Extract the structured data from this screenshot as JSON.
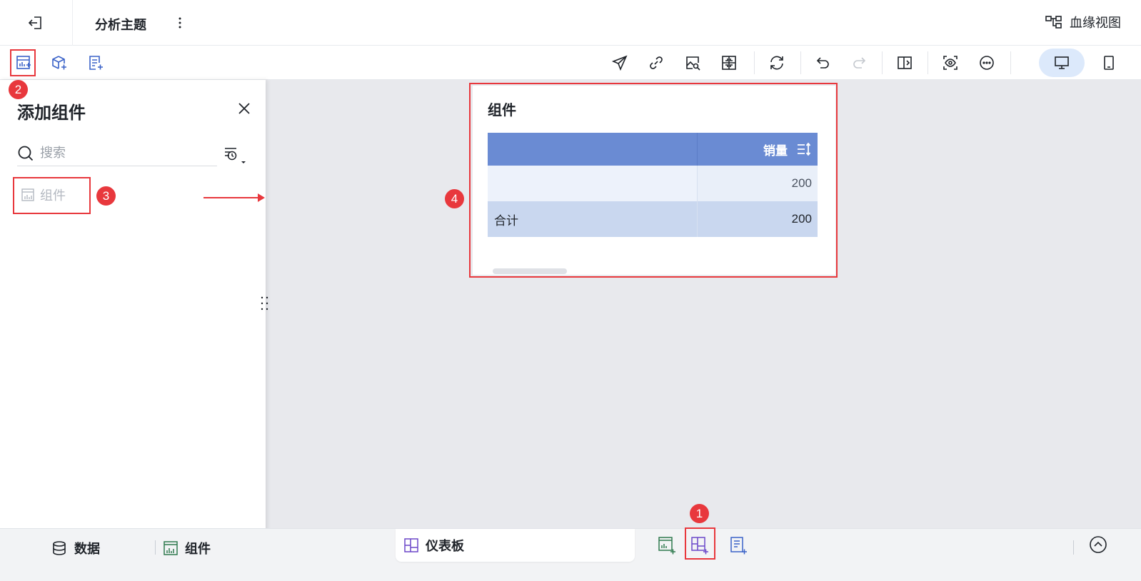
{
  "header": {
    "title": "分析主题",
    "lineage_label": "血缘视图"
  },
  "panel": {
    "title": "添加组件",
    "search_placeholder": "搜索",
    "items": [
      {
        "label": "组件"
      }
    ]
  },
  "widget": {
    "title": "组件",
    "table": {
      "columns": [
        "",
        "销量"
      ],
      "rows": [
        [
          "",
          "200"
        ],
        [
          "合计",
          "200"
        ]
      ]
    }
  },
  "bottom": {
    "data_tab": "数据",
    "component_tab": "组件",
    "dashboard_tab": "仪表板"
  },
  "annotations": {
    "badge_1": "1",
    "badge_2": "2",
    "badge_3": "3",
    "badge_4": "4",
    "color": "#e8383d"
  },
  "colors": {
    "accent": "#3a62c8",
    "table_header": "#6a8bd3",
    "device_active": "#dce9fb",
    "canvas": "#e8e9ed"
  }
}
